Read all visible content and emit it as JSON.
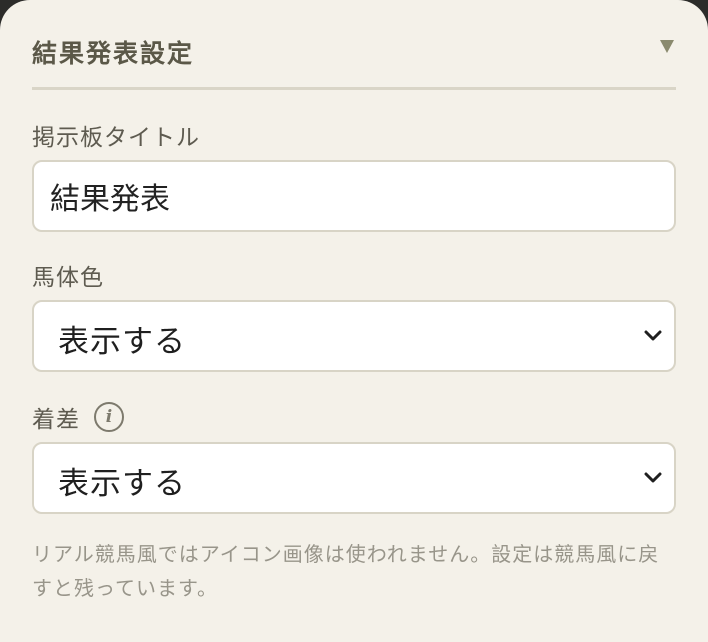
{
  "section": {
    "title": "結果発表設定",
    "collapse_icon": "triangle-down-icon"
  },
  "board_title": {
    "label": "掲示板タイトル",
    "value": "結果発表"
  },
  "horse_color": {
    "label": "馬体色",
    "selected": "表示する"
  },
  "margin": {
    "label": "着差",
    "info_icon": "i",
    "selected": "表示する"
  },
  "note": "リアル競馬風ではアイコン画像は使われません。設定は競馬風に戻すと残っています。",
  "colors": {
    "panel_bg": "#f4f1e9",
    "title": "#5b5848",
    "note": "#98958a"
  }
}
